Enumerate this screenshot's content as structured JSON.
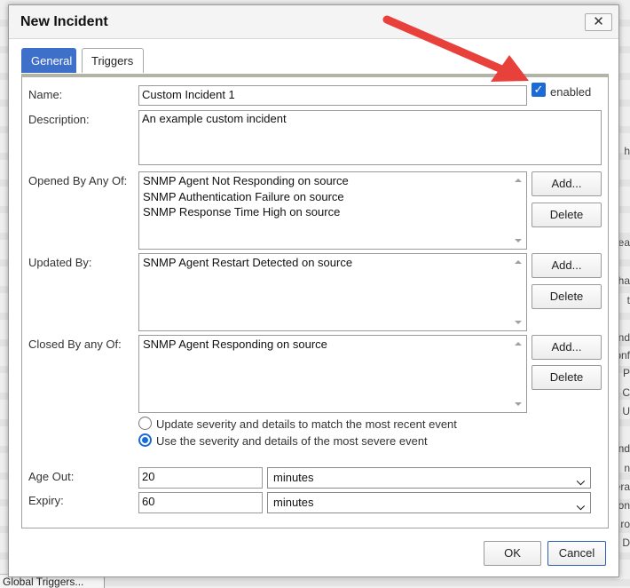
{
  "background": {
    "bottom_tab_label": "Global Triggers...",
    "right_edge_snippets": [
      "h",
      "ea",
      "ha",
      "t",
      "and",
      "onf",
      "P",
      "n C",
      "d U",
      "nd",
      "n",
      "era",
      "on",
      "ro",
      "D"
    ]
  },
  "dialog": {
    "title": "New Incident",
    "close_label": "✕",
    "tabs": [
      {
        "label": "General",
        "active": true
      },
      {
        "label": "Triggers",
        "active": false
      }
    ],
    "fields": {
      "name_label": "Name:",
      "name_value": "Custom Incident 1",
      "enabled_label": "enabled",
      "enabled_checked": true,
      "description_label": "Description:",
      "description_value": "An example custom incident",
      "opened_by_label": "Opened By Any Of:",
      "opened_by_items": [
        "SNMP Agent Not Responding on source",
        "SNMP Authentication Failure on source",
        "SNMP Response Time High on source"
      ],
      "updated_by_label": "Updated By:",
      "updated_by_items": [
        "SNMP Agent Restart Detected on source"
      ],
      "closed_by_label": "Closed By any Of:",
      "closed_by_items": [
        "SNMP Agent Responding on source"
      ],
      "add_label": "Add...",
      "delete_label": "Delete",
      "radio_options": [
        {
          "label": "Update severity and details to match the most recent event",
          "selected": false
        },
        {
          "label": "Use the severity and details of the most severe event",
          "selected": true
        }
      ],
      "age_out_label": "Age Out:",
      "age_out_value": "20",
      "age_out_unit": "minutes",
      "expiry_label": "Expiry:",
      "expiry_value": "60",
      "expiry_unit": "minutes"
    },
    "footer": {
      "ok_label": "OK",
      "cancel_label": "Cancel"
    }
  },
  "colors": {
    "tab_active": "#3e6fc9",
    "checkbox": "#1a6bd6",
    "annotation_arrow": "#e8403a"
  },
  "icons": {
    "close": "close-icon",
    "dropdown": "chevron-down-icon",
    "scroll_up": "scroll-up-icon",
    "scroll_down": "scroll-down-icon"
  }
}
